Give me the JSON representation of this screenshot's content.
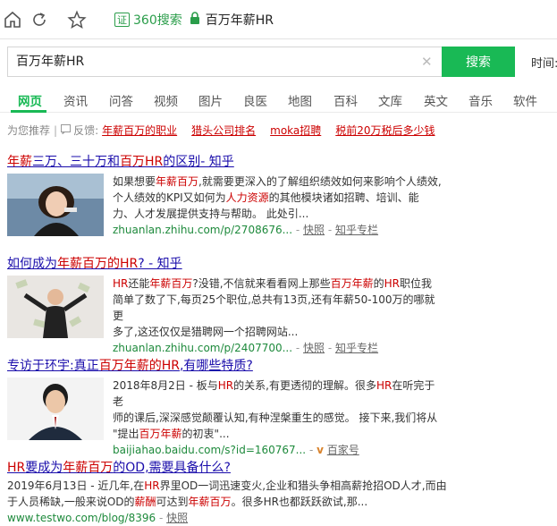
{
  "browser": {
    "cert_label": "证",
    "site_name": "360搜索",
    "page_title": "百万年薪HR"
  },
  "search": {
    "query": "百万年薪HR",
    "button_label": "搜索",
    "time_label": "时间:"
  },
  "tabs": [
    "网页",
    "资讯",
    "问答",
    "视频",
    "图片",
    "良医",
    "地图",
    "百科",
    "文库",
    "英文",
    "音乐",
    "软件"
  ],
  "recommend": {
    "label": "为您推荐",
    "feedback": "反馈:",
    "links": [
      "年薪百万的职业",
      "猎头公司排名",
      "moka招聘",
      "税前20万税后多少钱"
    ]
  },
  "results": [
    {
      "title_a": "年薪",
      "title_b": "三万、三十万和",
      "title_c": "百万HR",
      "title_d": "的区别- 知乎",
      "lines": [
        [
          "如果想要",
          "年薪百万",
          ",就需要更深入的了解组织绩效如何来影响个人绩效,"
        ],
        [
          "个人绩效的KPI又如何为",
          "人力资源",
          "的其他模块诸如招聘、培训、能"
        ],
        [
          "力、人才发展提供支持与帮助。 此处引...",
          "",
          ""
        ]
      ],
      "url": "zhuanlan.zhihu.com/p/2708676...",
      "snapshot": "快照",
      "extra": "知乎专栏"
    },
    {
      "title_a": "如何成为",
      "title_b": "年薪百万",
      "title_c": "的HR",
      "title_d": "? - 知乎",
      "lines": [
        [
          "",
          "HR",
          "还能",
          "年薪百万",
          "?没错,不信就来看看网上那些",
          "百万年薪",
          "的",
          "HR",
          "职位我"
        ],
        [
          "简单了数了下,每页25个职位,总共有13页,还有年薪50-100万的哪就更",
          "",
          "",
          "",
          "",
          "",
          "",
          "",
          ""
        ],
        [
          "多了,这还仅仅是猎聘网一个招聘网站...",
          "",
          "",
          "",
          "",
          "",
          "",
          "",
          ""
        ]
      ],
      "url": "zhuanlan.zhihu.com/p/2407700...",
      "snapshot": "快照",
      "extra": "知乎专栏"
    },
    {
      "title_a": "专访于环宇:真正",
      "title_b": "百万年薪",
      "title_c": "的HR",
      "title_d": ",有哪些特质?",
      "lines": [
        [
          "2018年8月2日 - 板与",
          "HR",
          "的关系,有更透彻的理解。很多",
          "HR",
          "在听完于老"
        ],
        [
          "师的课后,深深感觉颠覆认知,有种涅槃重生的感觉。 接下来,我们将从",
          "",
          "",
          "",
          ""
        ],
        [
          "\"提出",
          "百万年薪",
          "的初衷\"...",
          "",
          ""
        ]
      ],
      "url": "baijiahao.baidu.com/s?id=160767...",
      "snapshot": "",
      "extra": "百家号"
    },
    {
      "title_a": "HR",
      "title_b": "要成为",
      "title_c": "年薪百万",
      "title_d": "的OD,需要具备什么?",
      "lines": [
        [
          "2019年6月13日 - 近几年,在",
          "HR",
          "界里OD一词迅速变火,企业和猎头争相高薪抢招OD人才,而由"
        ],
        [
          "于人员稀缺,一般来说OD的",
          "薪酬",
          "可达到",
          "年薪百万",
          "。很多HR也都跃跃欲试,那..."
        ]
      ],
      "url": "www.testwo.com/blog/8396",
      "snapshot": "快照",
      "extra": ""
    }
  ]
}
